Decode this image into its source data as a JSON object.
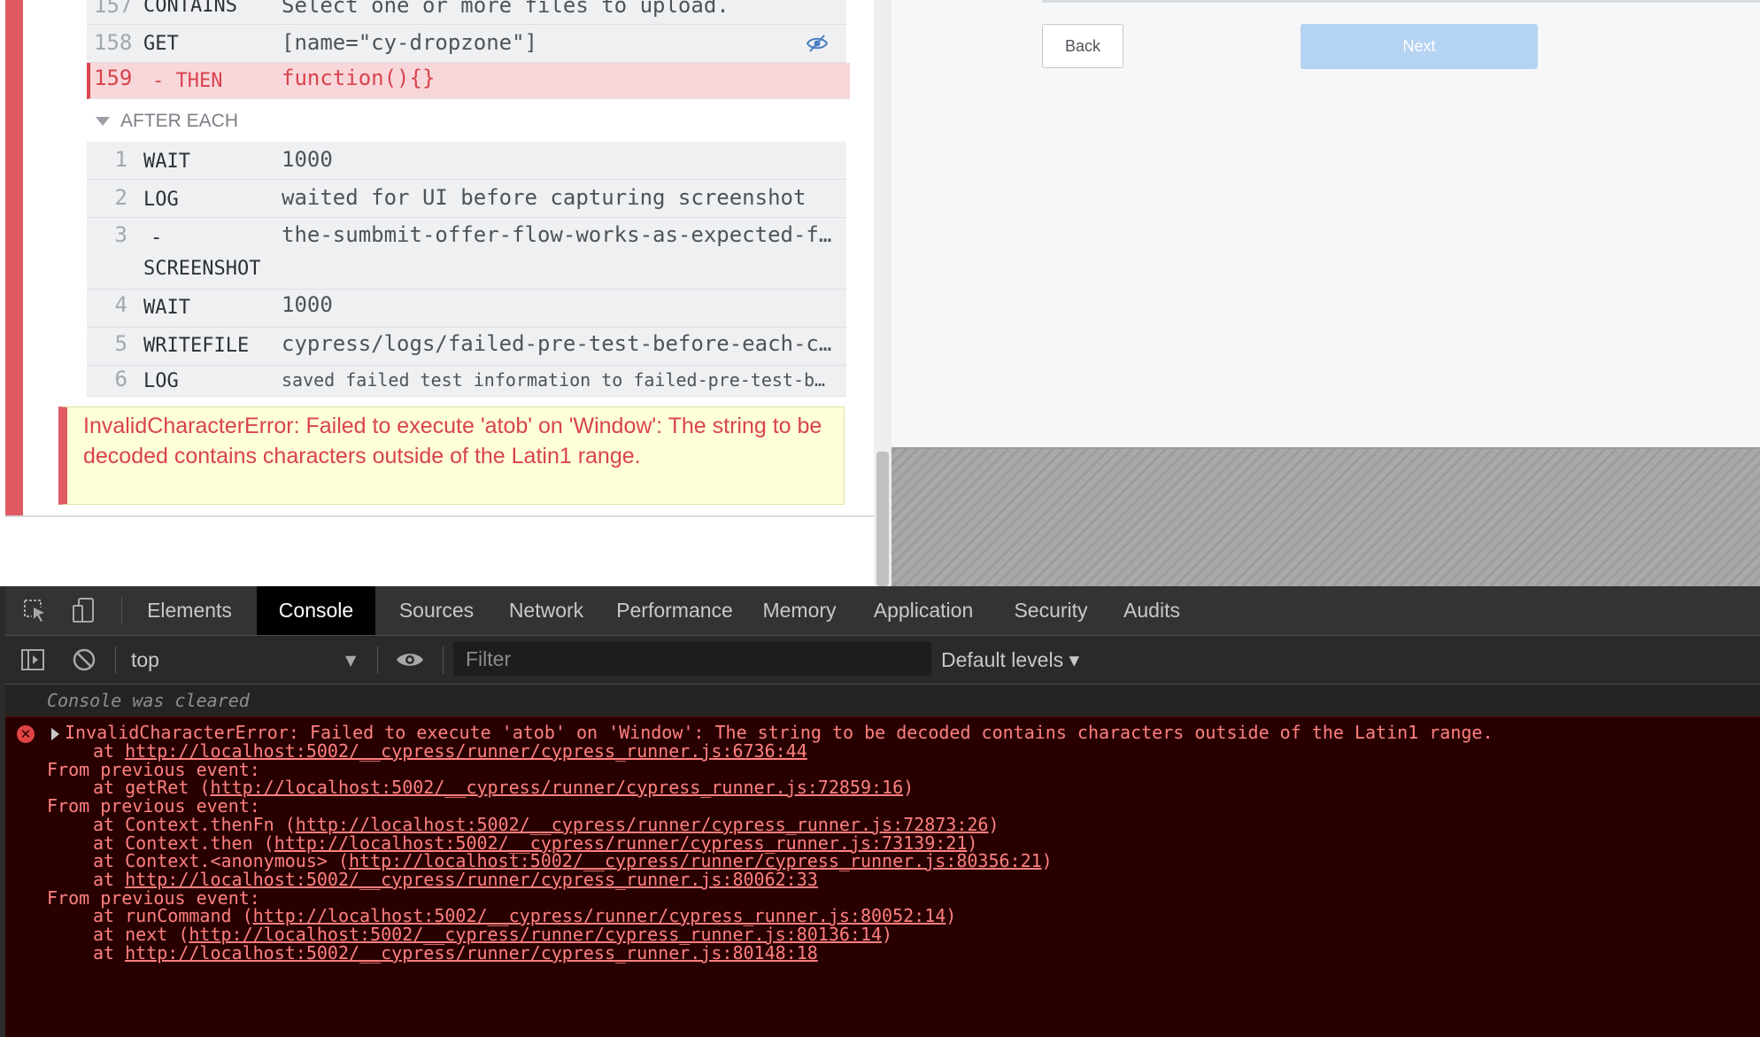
{
  "reporter": {
    "commands_top": [
      {
        "num": "157",
        "name": "CONTAINS",
        "msg": "Select one or more files to upload."
      },
      {
        "num": "158",
        "name": "GET",
        "msg": "[name=\"cy-dropzone\"]"
      },
      {
        "num": "159",
        "name": "- THEN",
        "msg": "function(){}"
      }
    ],
    "after_each_label": "AFTER EACH",
    "after_each": [
      {
        "num": "1",
        "name": "WAIT",
        "msg": "1000"
      },
      {
        "num": "2",
        "name": "LOG",
        "msg": "waited for UI before capturing screenshot"
      },
      {
        "num": "3",
        "name": "-",
        "name2": "SCREENSHOT",
        "msg": "the-sumbmit-offer-flow-works-as-expected-f…"
      },
      {
        "num": "4",
        "name": "WAIT",
        "msg": "1000"
      },
      {
        "num": "5",
        "name": "WRITEFILE",
        "msg": "cypress/logs/failed-pre-test-before-each-c…"
      },
      {
        "num": "6",
        "name": "LOG",
        "msg": "saved failed test information to failed-pre-test-b…"
      }
    ],
    "error_message": "InvalidCharacterError: Failed to execute 'atob' on 'Window': The string to be decoded contains characters outside of the Latin1 range."
  },
  "aut": {
    "back_label": "Back",
    "next_label": "Next"
  },
  "devtools": {
    "tabs": [
      "Elements",
      "Console",
      "Sources",
      "Network",
      "Performance",
      "Memory",
      "Application",
      "Security",
      "Audits"
    ],
    "active_tab": "Console",
    "context": "top",
    "filter_placeholder": "Filter",
    "levels_label": "Default levels ▾",
    "cleared": "Console was cleared",
    "error_head": "InvalidCharacterError: Failed to execute 'atob' on 'Window': The string to be decoded contains characters outside of the Latin1 range.",
    "from_label": "From previous event:",
    "stack": [
      {
        "prefix": "at ",
        "fn": "",
        "url": "http://localhost:5002/__cypress/runner/cypress_runner.js:6736:44"
      },
      {
        "from": true
      },
      {
        "prefix": "at ",
        "fn": "getRet ",
        "url": "http://localhost:5002/__cypress/runner/cypress_runner.js:72859:16"
      },
      {
        "from": true
      },
      {
        "prefix": "at ",
        "fn": "Context.thenFn ",
        "url": "http://localhost:5002/__cypress/runner/cypress_runner.js:72873:26"
      },
      {
        "prefix": "at ",
        "fn": "Context.then ",
        "url": "http://localhost:5002/__cypress/runner/cypress_runner.js:73139:21"
      },
      {
        "prefix": "at ",
        "fn": "Context.<anonymous> ",
        "url": "http://localhost:5002/__cypress/runner/cypress_runner.js:80356:21"
      },
      {
        "prefix": "at ",
        "fn": "",
        "url": "http://localhost:5002/__cypress/runner/cypress_runner.js:80062:33"
      },
      {
        "from": true
      },
      {
        "prefix": "at ",
        "fn": "runCommand ",
        "url": "http://localhost:5002/__cypress/runner/cypress_runner.js:80052:14"
      },
      {
        "prefix": "at ",
        "fn": "next ",
        "url": "http://localhost:5002/__cypress/runner/cypress_runner.js:80136:14"
      },
      {
        "prefix": "at ",
        "fn": "",
        "url": "http://localhost:5002/__cypress/runner/cypress_runner.js:80148:18"
      }
    ]
  },
  "colors": {
    "fail_red": "#d9434e",
    "reporter_fail_bar": "#e05a64",
    "console_error_bg": "#290000",
    "console_error_text": "#ff8080",
    "next_button": "#b5d3f2"
  }
}
